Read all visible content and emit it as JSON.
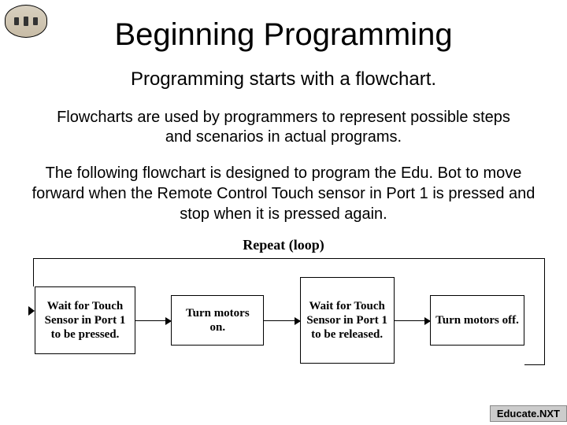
{
  "title": "Beginning Programming",
  "subtitle": "Programming starts with a flowchart.",
  "intro": "Flowcharts are used by programmers to represent possible steps and scenarios in actual programs.",
  "description": "The following flowchart is designed to program the Edu. Bot to move forward when the Remote Control Touch sensor in Port 1 is pressed and stop when it is pressed again.",
  "loop_label": "Repeat (loop)",
  "steps": [
    "Wait for Touch Sensor in Port 1 to be pressed.",
    "Turn motors on.",
    "Wait for Touch Sensor in Port 1 to be released.",
    "Turn motors off."
  ],
  "footer": "Educate.NXT"
}
